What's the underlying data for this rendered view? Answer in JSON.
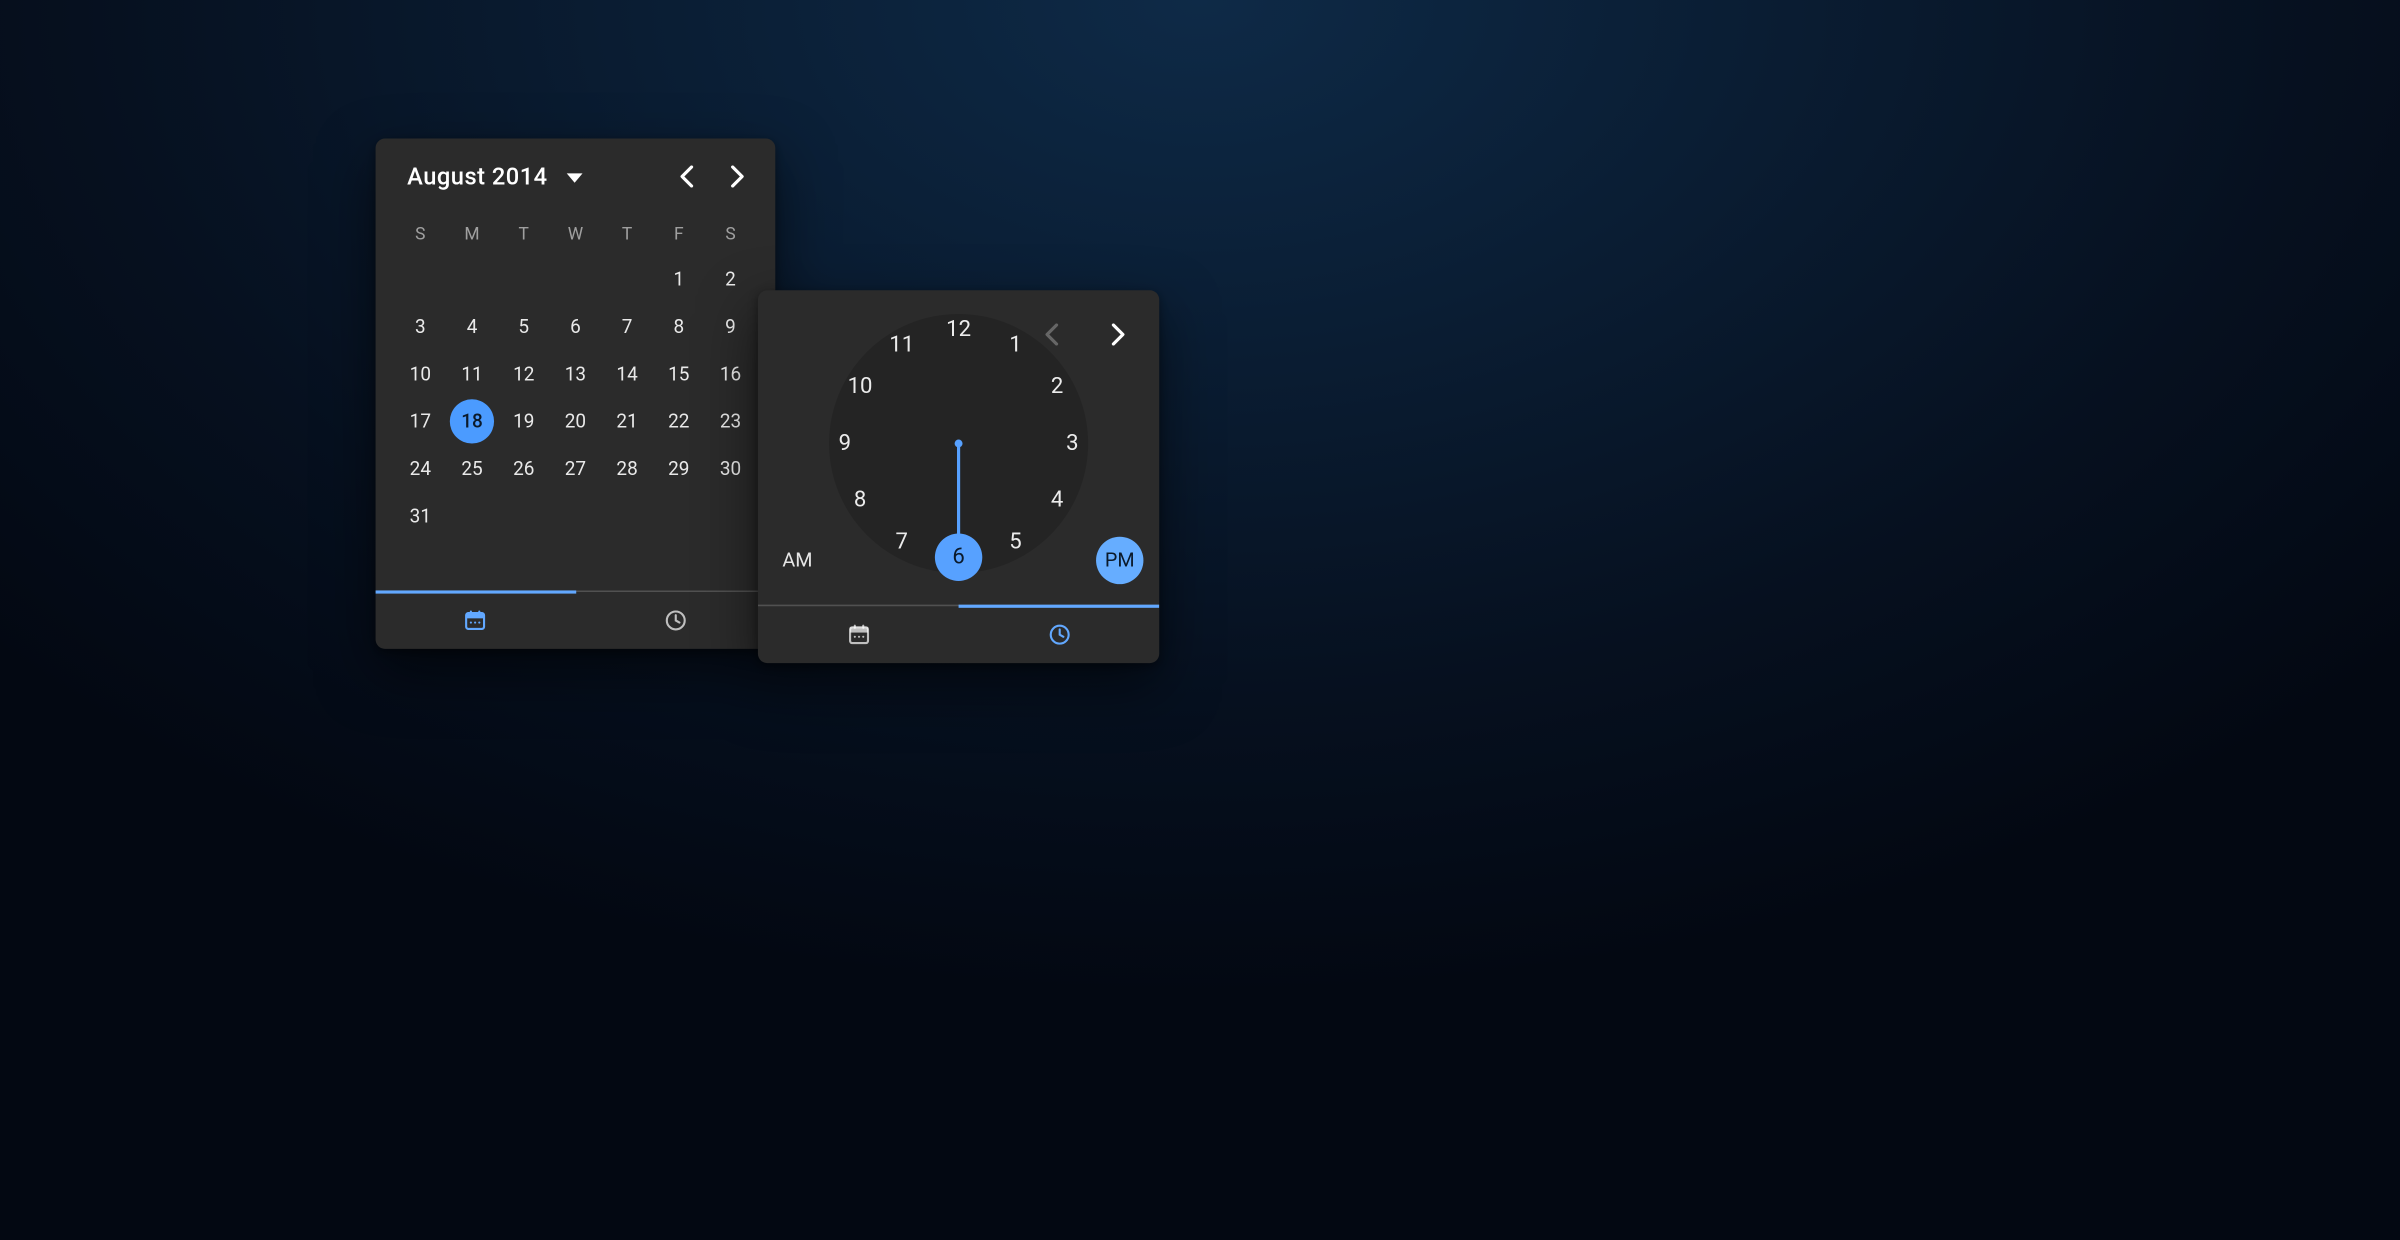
{
  "accent": "#57a1ff",
  "date_picker": {
    "month_label": "August 2014",
    "weekdays": [
      "S",
      "M",
      "T",
      "W",
      "T",
      "F",
      "S"
    ],
    "leading_blanks": 5,
    "days_in_month": 31,
    "selected_day": 18,
    "tabs": {
      "active": "date"
    }
  },
  "time_picker": {
    "hours": [
      12,
      1,
      2,
      3,
      4,
      5,
      6,
      7,
      8,
      9,
      10,
      11
    ],
    "selected_hour": 6,
    "am_label": "AM",
    "pm_label": "PM",
    "selected_period": "PM",
    "nav_prev_enabled": false,
    "nav_next_enabled": true,
    "tabs": {
      "active": "time"
    }
  }
}
